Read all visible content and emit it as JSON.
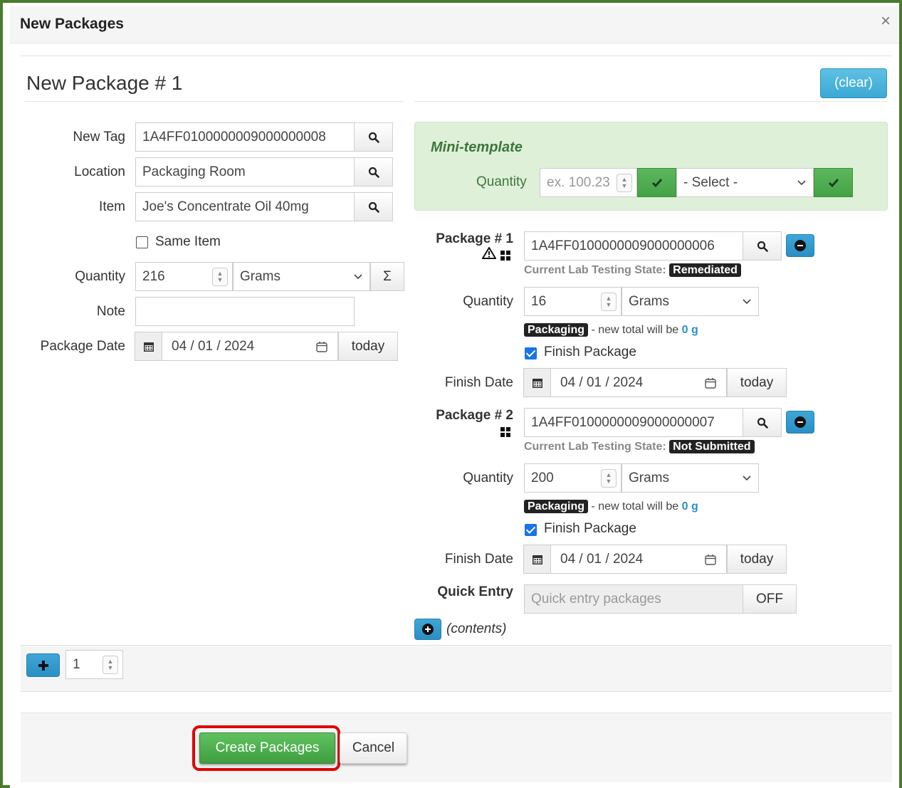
{
  "dialog": {
    "title": "New Packages",
    "close_glyph": "×"
  },
  "package_header": "New Package # 1",
  "clear_button": "(clear)",
  "form": {
    "new_tag_label": "New Tag",
    "new_tag_value": "1A4FF0100000009000000008",
    "location_label": "Location",
    "location_value": "Packaging Room",
    "item_label": "Item",
    "item_value": "Joe's Concentrate Oil 40mg",
    "same_item_label": "Same Item",
    "quantity_label": "Quantity",
    "quantity_value": "216",
    "unit_value": "Grams",
    "sum_glyph": "Σ",
    "note_label": "Note",
    "note_value": "",
    "package_date_label": "Package Date",
    "package_date_value": "04 / 01 / 2024",
    "today_label": "today"
  },
  "mini_template": {
    "title": "Mini-template",
    "quantity_label": "Quantity",
    "quantity_placeholder": "ex. 100.23",
    "select_value": "- Select -"
  },
  "sources": [
    {
      "label": "Package # 1",
      "tag": "1A4FF0100000009000000006",
      "lab_state_label": "Current Lab Testing State:",
      "lab_state": "Remediated",
      "quantity_label": "Quantity",
      "quantity": "16",
      "unit": "Grams",
      "packaging_badge": "Packaging",
      "new_total_text": "- new total will be",
      "new_total_value": "0 g",
      "finish_label": "Finish Package",
      "finish_date_label": "Finish Date",
      "finish_date": "04 / 01 / 2024",
      "today_label": "today"
    },
    {
      "label": "Package # 2",
      "tag": "1A4FF0100000009000000007",
      "lab_state_label": "Current Lab Testing State:",
      "lab_state": "Not Submitted",
      "quantity_label": "Quantity",
      "quantity": "200",
      "unit": "Grams",
      "packaging_badge": "Packaging",
      "new_total_text": "- new total will be",
      "new_total_value": "0 g",
      "finish_label": "Finish Package",
      "finish_date_label": "Finish Date",
      "finish_date": "04 / 01 / 2024",
      "today_label": "today"
    }
  ],
  "quick_entry": {
    "label": "Quick Entry",
    "placeholder": "Quick entry packages",
    "toggle": "OFF"
  },
  "contents_label": "(contents)",
  "add_count": "1",
  "footer": {
    "create_label": "Create Packages",
    "cancel_label": "Cancel"
  },
  "colors": {
    "accent_green": "#5cb85c",
    "info_blue": "#3aa9d4",
    "highlight_red": "#e00000",
    "frame_green": "#4a7b2c"
  }
}
